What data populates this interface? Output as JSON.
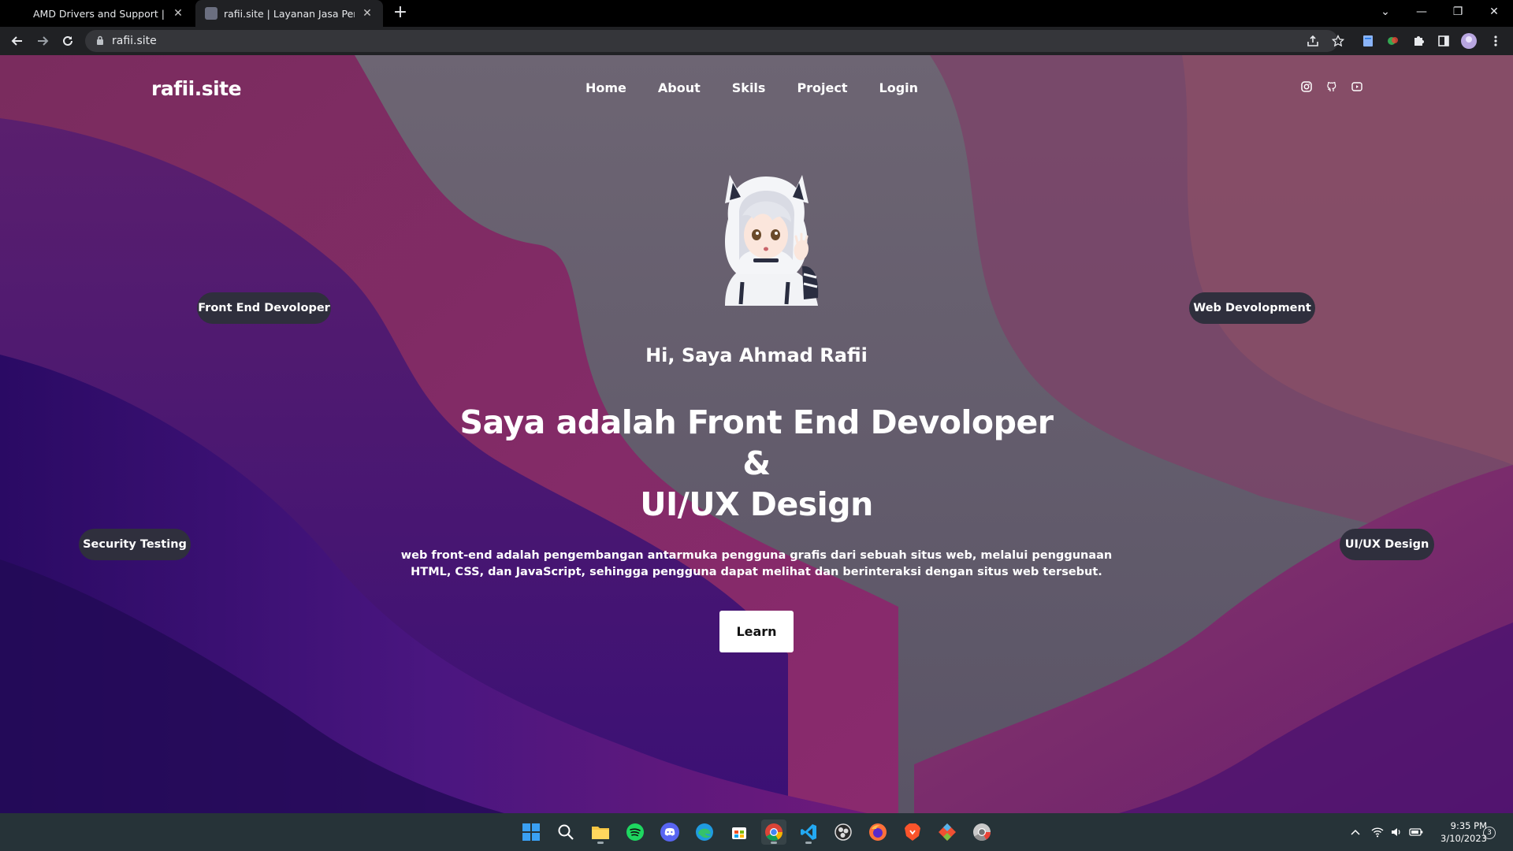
{
  "browser": {
    "tabs": [
      {
        "title": "AMD Drivers and Support | AMD",
        "close_glyph": "✕"
      },
      {
        "title": "rafii.site | Layanan Jasa Pembuata",
        "close_glyph": "✕"
      }
    ],
    "new_tab_glyph": "+",
    "url": "rafii.site",
    "window_controls": {
      "dropdown": "⌄",
      "minimize": "—",
      "restore": "❐",
      "close": "✕"
    }
  },
  "site": {
    "logo": "rafii.site",
    "nav": [
      "Home",
      "About",
      "Skils",
      "Project",
      "Login"
    ],
    "socials": [
      "instagram-icon",
      "github-icon",
      "youtube-icon"
    ],
    "greeting": "Hi, Saya Ahmad Rafii",
    "headline": {
      "line1": "Saya adalah Front End Devoloper",
      "line2": "&",
      "line3": "UI/UX Design"
    },
    "description": "web front-end adalah pengembangan antarmuka pengguna grafis dari sebuah situs web, melalui penggunaan HTML, CSS, dan JavaScript, sehingga pengguna dapat melihat dan berinteraksi dengan situs web tersebut.",
    "cta": "Learn",
    "pills": [
      "Front End Devoloper",
      "Web Devolopment",
      "Security Testing",
      "UI/UX Design"
    ]
  },
  "taskbar": {
    "apps": [
      "start-icon",
      "search-icon",
      "file-explorer-icon",
      "spotify-icon",
      "discord-icon",
      "edge-icon",
      "store-icon",
      "chrome-icon",
      "vscode-icon",
      "obs-icon",
      "firefox-icon",
      "brave-icon",
      "git-icon",
      "chrome-dev-icon"
    ],
    "time": "9:35 PM",
    "date": "3/10/2023",
    "notifications": "3"
  },
  "colors": {
    "tab_bar": "#000000",
    "toolbar": "#202124",
    "taskbar": "#263338",
    "pill_bg": "#2f2f3d",
    "bg_deep_purple": "#3a0f6b",
    "bg_magenta": "#7b1f6a"
  }
}
